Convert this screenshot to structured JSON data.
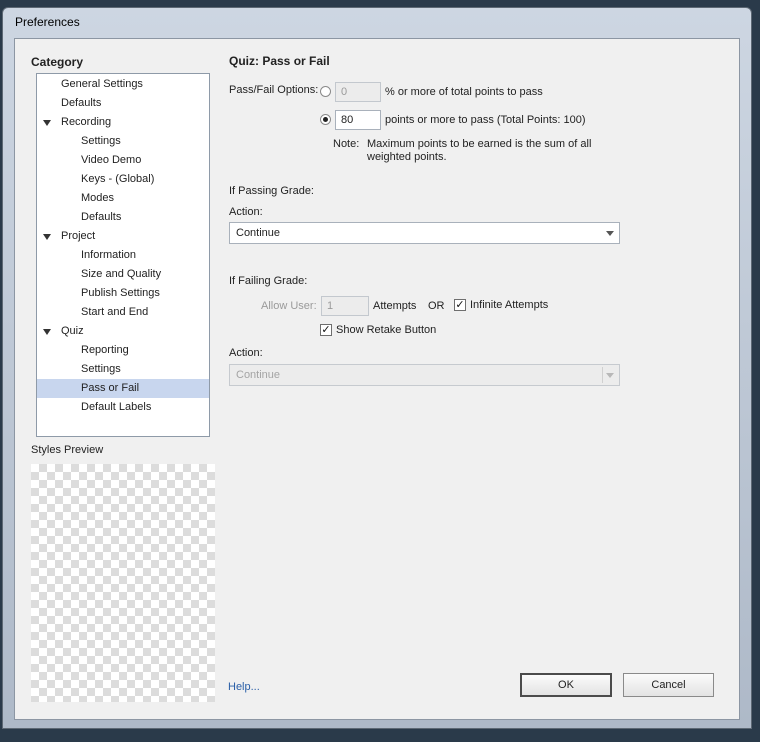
{
  "window": {
    "title": "Preferences"
  },
  "sidebar": {
    "category_label": "Category",
    "items": [
      {
        "label": "General Settings"
      },
      {
        "label": "Defaults"
      },
      {
        "label": "Recording"
      },
      {
        "label": "Settings"
      },
      {
        "label": "Video Demo"
      },
      {
        "label": "Keys - (Global)"
      },
      {
        "label": "Modes"
      },
      {
        "label": "Defaults"
      },
      {
        "label": "Project"
      },
      {
        "label": "Information"
      },
      {
        "label": "Size and Quality"
      },
      {
        "label": "Publish Settings"
      },
      {
        "label": "Start and End"
      },
      {
        "label": "Quiz"
      },
      {
        "label": "Reporting"
      },
      {
        "label": "Settings"
      },
      {
        "label": "Pass or Fail"
      },
      {
        "label": "Default Labels"
      }
    ],
    "selected_item": "Pass or Fail",
    "styles_preview_label": "Styles Preview"
  },
  "main": {
    "section_title": "Quiz: Pass or Fail",
    "pass_fail_options_label": "Pass/Fail Options:",
    "percent_option": {
      "value": "0",
      "suffix": "% or more of total points to pass",
      "selected": false
    },
    "points_option": {
      "value": "80",
      "suffix": "points or more to pass (Total Points: 100)",
      "selected": true
    },
    "note_label": "Note:",
    "note_text_line1": "Maximum points to be earned is the sum of all",
    "note_text_line2": "weighted points.",
    "passing": {
      "heading": "If Passing Grade:",
      "action_label": "Action:",
      "action_value": "Continue"
    },
    "failing": {
      "heading": "If Failing Grade:",
      "allow_user_label": "Allow User:",
      "attempts_value": "1",
      "attempts_label": "Attempts",
      "or_label": "OR",
      "infinite_attempts_label": "Infinite Attempts",
      "infinite_attempts_checked": true,
      "show_retake_label": "Show Retake Button",
      "show_retake_checked": true,
      "action_label": "Action:",
      "action_value": "Continue"
    }
  },
  "footer": {
    "help_link": "Help...",
    "ok_label": "OK",
    "cancel_label": "Cancel"
  }
}
